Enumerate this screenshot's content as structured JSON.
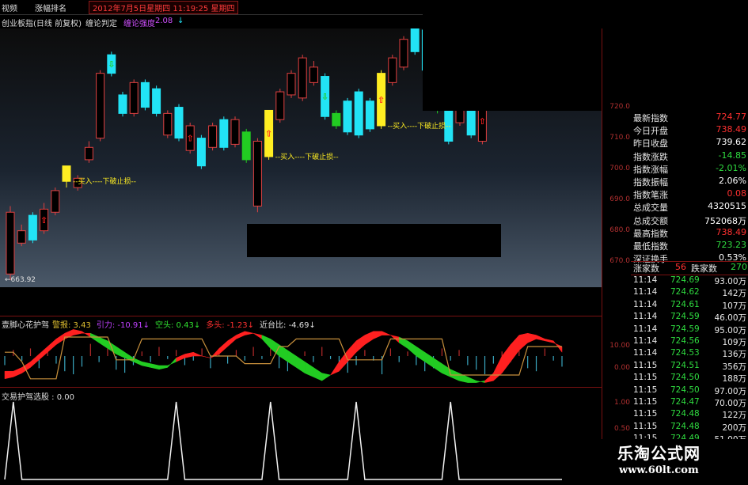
{
  "topbar": {
    "tab_left": "视频",
    "tab_rank": "涨幅排名",
    "datetime": "2012年7月5日星期四  11:19:25 星期四"
  },
  "titlebar": {
    "instrument": "创业板指(日线 前复权)",
    "judge": "缠论判定",
    "strength_label": "缠论强度",
    "strength_value": "2.08"
  },
  "colors": {
    "cyan": "#22e3f5",
    "yellow": "#ffee22",
    "green": "#22cc22",
    "red": "#ff2020",
    "up_hollow": "#e04040",
    "orange_line": "#c8903c"
  },
  "chart_data": [
    {
      "type": "candlestick",
      "title": "创业板指(日线 前复权)",
      "ylim": [
        663,
        745
      ],
      "yticks": [
        670.0,
        680.0,
        690.0,
        700.0,
        710.0,
        720.0
      ],
      "low_marker": "663.92",
      "candles": [
        {
          "o": 666,
          "c": 686,
          "h": 688,
          "l": 664,
          "kind": "up"
        },
        {
          "o": 680,
          "c": 676,
          "h": 682,
          "l": 675,
          "kind": "up"
        },
        {
          "o": 685,
          "c": 677,
          "h": 686,
          "l": 676,
          "kind": "cyan"
        },
        {
          "o": 680,
          "c": 687,
          "h": 689,
          "l": 679,
          "kind": "up"
        },
        {
          "o": 686,
          "c": 693,
          "h": 694,
          "l": 685,
          "kind": "up"
        },
        {
          "o": 696,
          "c": 701,
          "h": 701,
          "l": 694,
          "kind": "yellow"
        },
        {
          "o": 694,
          "c": 697,
          "h": 698,
          "l": 693,
          "kind": "up"
        },
        {
          "o": 703,
          "c": 707,
          "h": 709,
          "l": 702,
          "kind": "up"
        },
        {
          "o": 710,
          "c": 731,
          "h": 732,
          "l": 709,
          "kind": "up"
        },
        {
          "o": 737,
          "c": 731,
          "h": 738,
          "l": 730,
          "kind": "cyan"
        },
        {
          "o": 724,
          "c": 718,
          "h": 725,
          "l": 717,
          "kind": "cyan"
        },
        {
          "o": 718,
          "c": 728,
          "h": 729,
          "l": 717,
          "kind": "up"
        },
        {
          "o": 728,
          "c": 720,
          "h": 729,
          "l": 719,
          "kind": "cyan"
        },
        {
          "o": 726,
          "c": 718,
          "h": 727,
          "l": 717,
          "kind": "cyan"
        },
        {
          "o": 711,
          "c": 718,
          "h": 719,
          "l": 710,
          "kind": "up"
        },
        {
          "o": 720,
          "c": 710,
          "h": 721,
          "l": 709,
          "kind": "cyan"
        },
        {
          "o": 706,
          "c": 714,
          "h": 715,
          "l": 705,
          "kind": "up"
        },
        {
          "o": 710,
          "c": 701,
          "h": 711,
          "l": 700,
          "kind": "cyan"
        },
        {
          "o": 707,
          "c": 714,
          "h": 715,
          "l": 706,
          "kind": "up"
        },
        {
          "o": 716,
          "c": 707,
          "h": 717,
          "l": 706,
          "kind": "cyan"
        },
        {
          "o": 708,
          "c": 716,
          "h": 717,
          "l": 707,
          "kind": "up"
        },
        {
          "o": 712,
          "c": 703,
          "h": 713,
          "l": 702,
          "kind": "green"
        },
        {
          "o": 688,
          "c": 709,
          "h": 710,
          "l": 686,
          "kind": "up"
        },
        {
          "o": 704,
          "c": 719,
          "h": 719,
          "l": 703,
          "kind": "yellow"
        },
        {
          "o": 716,
          "c": 725,
          "h": 726,
          "l": 715,
          "kind": "up"
        },
        {
          "o": 731,
          "c": 724,
          "h": 732,
          "l": 723,
          "kind": "up"
        },
        {
          "o": 736,
          "c": 723,
          "h": 737,
          "l": 722,
          "kind": "up"
        },
        {
          "o": 733,
          "c": 728,
          "h": 735,
          "l": 727,
          "kind": "up"
        },
        {
          "o": 730,
          "c": 717,
          "h": 731,
          "l": 716,
          "kind": "cyan"
        },
        {
          "o": 718,
          "c": 714,
          "h": 719,
          "l": 713,
          "kind": "green"
        },
        {
          "o": 722,
          "c": 712,
          "h": 723,
          "l": 711,
          "kind": "cyan"
        },
        {
          "o": 725,
          "c": 711,
          "h": 726,
          "l": 710,
          "kind": "cyan"
        },
        {
          "o": 722,
          "c": 713,
          "h": 723,
          "l": 712,
          "kind": "cyan"
        },
        {
          "o": 714,
          "c": 731,
          "h": 732,
          "l": 713,
          "kind": "yellow"
        },
        {
          "o": 728,
          "c": 736,
          "h": 737,
          "l": 727,
          "kind": "up"
        },
        {
          "o": 733,
          "c": 742,
          "h": 743,
          "l": 732,
          "kind": "up"
        },
        {
          "o": 746,
          "c": 738,
          "h": 747,
          "l": 737,
          "kind": "cyan"
        },
        {
          "o": 745,
          "c": 732,
          "h": 746,
          "l": 731,
          "kind": "cyan"
        },
        {
          "o": 725,
          "c": 719,
          "h": 726,
          "l": 718,
          "kind": "green"
        },
        {
          "o": 720,
          "c": 709,
          "h": 721,
          "l": 708,
          "kind": "cyan"
        },
        {
          "o": 721,
          "c": 715,
          "h": 722,
          "l": 714,
          "kind": "up"
        },
        {
          "o": 720,
          "c": 711,
          "h": 721,
          "l": 710,
          "kind": "cyan"
        },
        {
          "o": 722,
          "c": 709,
          "h": 723,
          "l": 708,
          "kind": "up"
        },
        {
          "o": 722,
          "c": 721,
          "h": 722,
          "l": 720,
          "kind": "cyan"
        }
      ],
      "arrows": [
        {
          "i": 3,
          "dir": "up",
          "color": "#ff2020"
        },
        {
          "i": 9,
          "dir": "down",
          "color": "#22cc22"
        },
        {
          "i": 16,
          "dir": "up",
          "color": "#ff2020"
        },
        {
          "i": 21,
          "dir": "down",
          "color": "#22cc22"
        },
        {
          "i": 23,
          "dir": "up",
          "color": "#ff2020"
        },
        {
          "i": 28,
          "dir": "down",
          "color": "#22cc22"
        },
        {
          "i": 33,
          "dir": "up",
          "color": "#ff2020"
        },
        {
          "i": 42,
          "dir": "up",
          "color": "#ff2020"
        }
      ],
      "annotations": [
        {
          "i": 5,
          "text": "--买入----下破止损--"
        },
        {
          "i": 23,
          "text": "--买入----下破止损--"
        },
        {
          "i": 33,
          "text": "--买入----下破止损--"
        }
      ]
    },
    {
      "type": "area",
      "title": "壹脚心花护驾",
      "ylim": [
        -15,
        15
      ],
      "yticks": [
        "10.00",
        "0.00"
      ],
      "legend": [
        {
          "name": "警报",
          "value": "3.43",
          "color": "#e0c030",
          "arrow": ""
        },
        {
          "name": "引力",
          "value": "-10.91",
          "color": "#c040ff",
          "arrow": "down"
        },
        {
          "name": "空头",
          "value": "0.43",
          "color": "#30e030",
          "arrow": "down"
        },
        {
          "name": "多头",
          "value": "-1.23",
          "color": "#ff3030",
          "arrow": "down"
        },
        {
          "name": "近台比",
          "value": "-4.69",
          "color": "#e0e0e0",
          "arrow": "down"
        }
      ],
      "fast": [
        -8,
        -8,
        -6,
        -3,
        1,
        5,
        9,
        12,
        14,
        13,
        10,
        7,
        4,
        1,
        -1,
        -3,
        -5,
        -6,
        -7,
        -6,
        -1,
        1,
        2,
        0,
        -1,
        4,
        8,
        11,
        13,
        12,
        9,
        4,
        0,
        -3,
        -6,
        -9,
        -11,
        -13,
        -10,
        -3,
        3,
        8,
        11,
        13,
        13,
        11,
        7,
        4,
        0,
        -3,
        -6,
        -9,
        -11,
        -13,
        -14,
        -14,
        -13,
        -9,
        0,
        6,
        11,
        12,
        11,
        9,
        8,
        2
      ],
      "slow": [
        -12,
        -11,
        -9,
        -6,
        -2,
        2,
        6,
        9,
        11,
        12,
        12,
        10,
        8,
        5,
        2,
        -1,
        -3,
        -4,
        -5,
        -5,
        -3,
        -1,
        0,
        0,
        -1,
        1,
        5,
        9,
        11,
        12,
        11,
        9,
        6,
        3,
        0,
        -3,
        -6,
        -9,
        -10,
        -8,
        -3,
        2,
        6,
        9,
        11,
        11,
        10,
        8,
        5,
        2,
        -1,
        -4,
        -7,
        -9,
        -11,
        -13,
        -14,
        -13,
        -9,
        -3,
        3,
        7,
        9,
        8,
        7,
        5
      ],
      "orange": [
        2,
        2,
        -3,
        -12,
        -12,
        -12,
        -12,
        10,
        10,
        10,
        10,
        10,
        10,
        -2,
        -2,
        -2,
        9,
        9,
        9,
        9,
        9,
        9,
        9,
        9,
        0,
        0,
        0,
        0,
        -4,
        -4,
        -4,
        -4,
        5,
        5,
        9,
        9,
        9,
        9,
        9,
        9,
        -2,
        -2,
        -2,
        -2,
        -2,
        9,
        9,
        9,
        9,
        9,
        9,
        9,
        -10,
        -10,
        -10,
        -10,
        -10,
        -10,
        -10,
        -10,
        -10,
        5,
        5,
        5,
        5,
        5
      ],
      "spikes": [
        -6,
        4,
        -3,
        5,
        -8,
        6,
        -5,
        -10,
        -12,
        -7,
        8,
        -4,
        5,
        -9,
        -11,
        -6,
        3,
        -4,
        6,
        -2,
        4,
        -6,
        -3,
        5,
        -8,
        3,
        -5,
        4,
        -3,
        6,
        -2,
        5,
        -8,
        -10,
        -7,
        3,
        -4,
        6,
        -2,
        -9,
        -11,
        -6,
        4,
        -3,
        -12,
        5,
        -4,
        3,
        -6,
        -10,
        -8,
        5,
        -3,
        4,
        -6,
        -9,
        -12,
        -5,
        3,
        -4,
        6,
        -8,
        -10,
        5,
        -3,
        -7
      ]
    },
    {
      "type": "line",
      "title": "交易护驾选股",
      "value_label": "0.00",
      "ylim": [
        0,
        1
      ],
      "yticks": [
        "1.00",
        "0.50",
        "0.00"
      ],
      "peaks_at": [
        1,
        20,
        31,
        41,
        52
      ],
      "n": 66
    }
  ],
  "quotes": [
    {
      "label": "最新指数",
      "value": "724.77",
      "color": "#ff3030"
    },
    {
      "label": "今日开盘",
      "value": "738.49",
      "color": "#ff3030"
    },
    {
      "label": "昨日收盘",
      "value": "739.62",
      "color": "#ffffff"
    },
    {
      "label": "指数涨跌",
      "value": "-14.85",
      "color": "#2fdc40"
    },
    {
      "label": "指数涨幅",
      "value": "-2.01%",
      "color": "#2fdc40"
    },
    {
      "label": "指数振幅",
      "value": "2.06%",
      "color": "#ffffff"
    },
    {
      "label": "指数笔涨",
      "value": "0.08",
      "color": "#ff3030"
    },
    {
      "label": "总成交量",
      "value": "4320515",
      "color": "#ffffff"
    },
    {
      "label": "总成交额",
      "value": "752068万",
      "color": "#ffffff"
    },
    {
      "label": "最高指数",
      "value": "738.49",
      "color": "#ff3030"
    },
    {
      "label": "最低指数",
      "value": "723.23",
      "color": "#2fdc40"
    },
    {
      "label": "深证换手",
      "value": "0.53%",
      "color": "#ffffff"
    }
  ],
  "breadth": {
    "up_label": "涨家数",
    "up_value": "56",
    "down_label": "跌家数",
    "down_value": "270"
  },
  "ticks": [
    {
      "t": "11:14",
      "p": "724.69",
      "v": "93.00万"
    },
    {
      "t": "11:14",
      "p": "724.62",
      "v": "142万"
    },
    {
      "t": "11:14",
      "p": "724.61",
      "v": "107万"
    },
    {
      "t": "11:14",
      "p": "724.59",
      "v": "46.00万"
    },
    {
      "t": "11:14",
      "p": "724.59",
      "v": "95.00万"
    },
    {
      "t": "11:14",
      "p": "724.56",
      "v": "109万"
    },
    {
      "t": "11:14",
      "p": "724.53",
      "v": "136万"
    },
    {
      "t": "11:15",
      "p": "724.51",
      "v": "356万"
    },
    {
      "t": "11:15",
      "p": "724.50",
      "v": "188万"
    },
    {
      "t": "11:15",
      "p": "724.50",
      "v": "97.00万"
    },
    {
      "t": "11:15",
      "p": "724.47",
      "v": "70.00万"
    },
    {
      "t": "11:15",
      "p": "724.48",
      "v": "122万"
    },
    {
      "t": "11:15",
      "p": "724.48",
      "v": "200万"
    },
    {
      "t": "11:15",
      "p": "724.49",
      "v": "51.00万"
    }
  ],
  "watermark": {
    "name": "乐淘公式网",
    "url": "www.60lt.com"
  }
}
